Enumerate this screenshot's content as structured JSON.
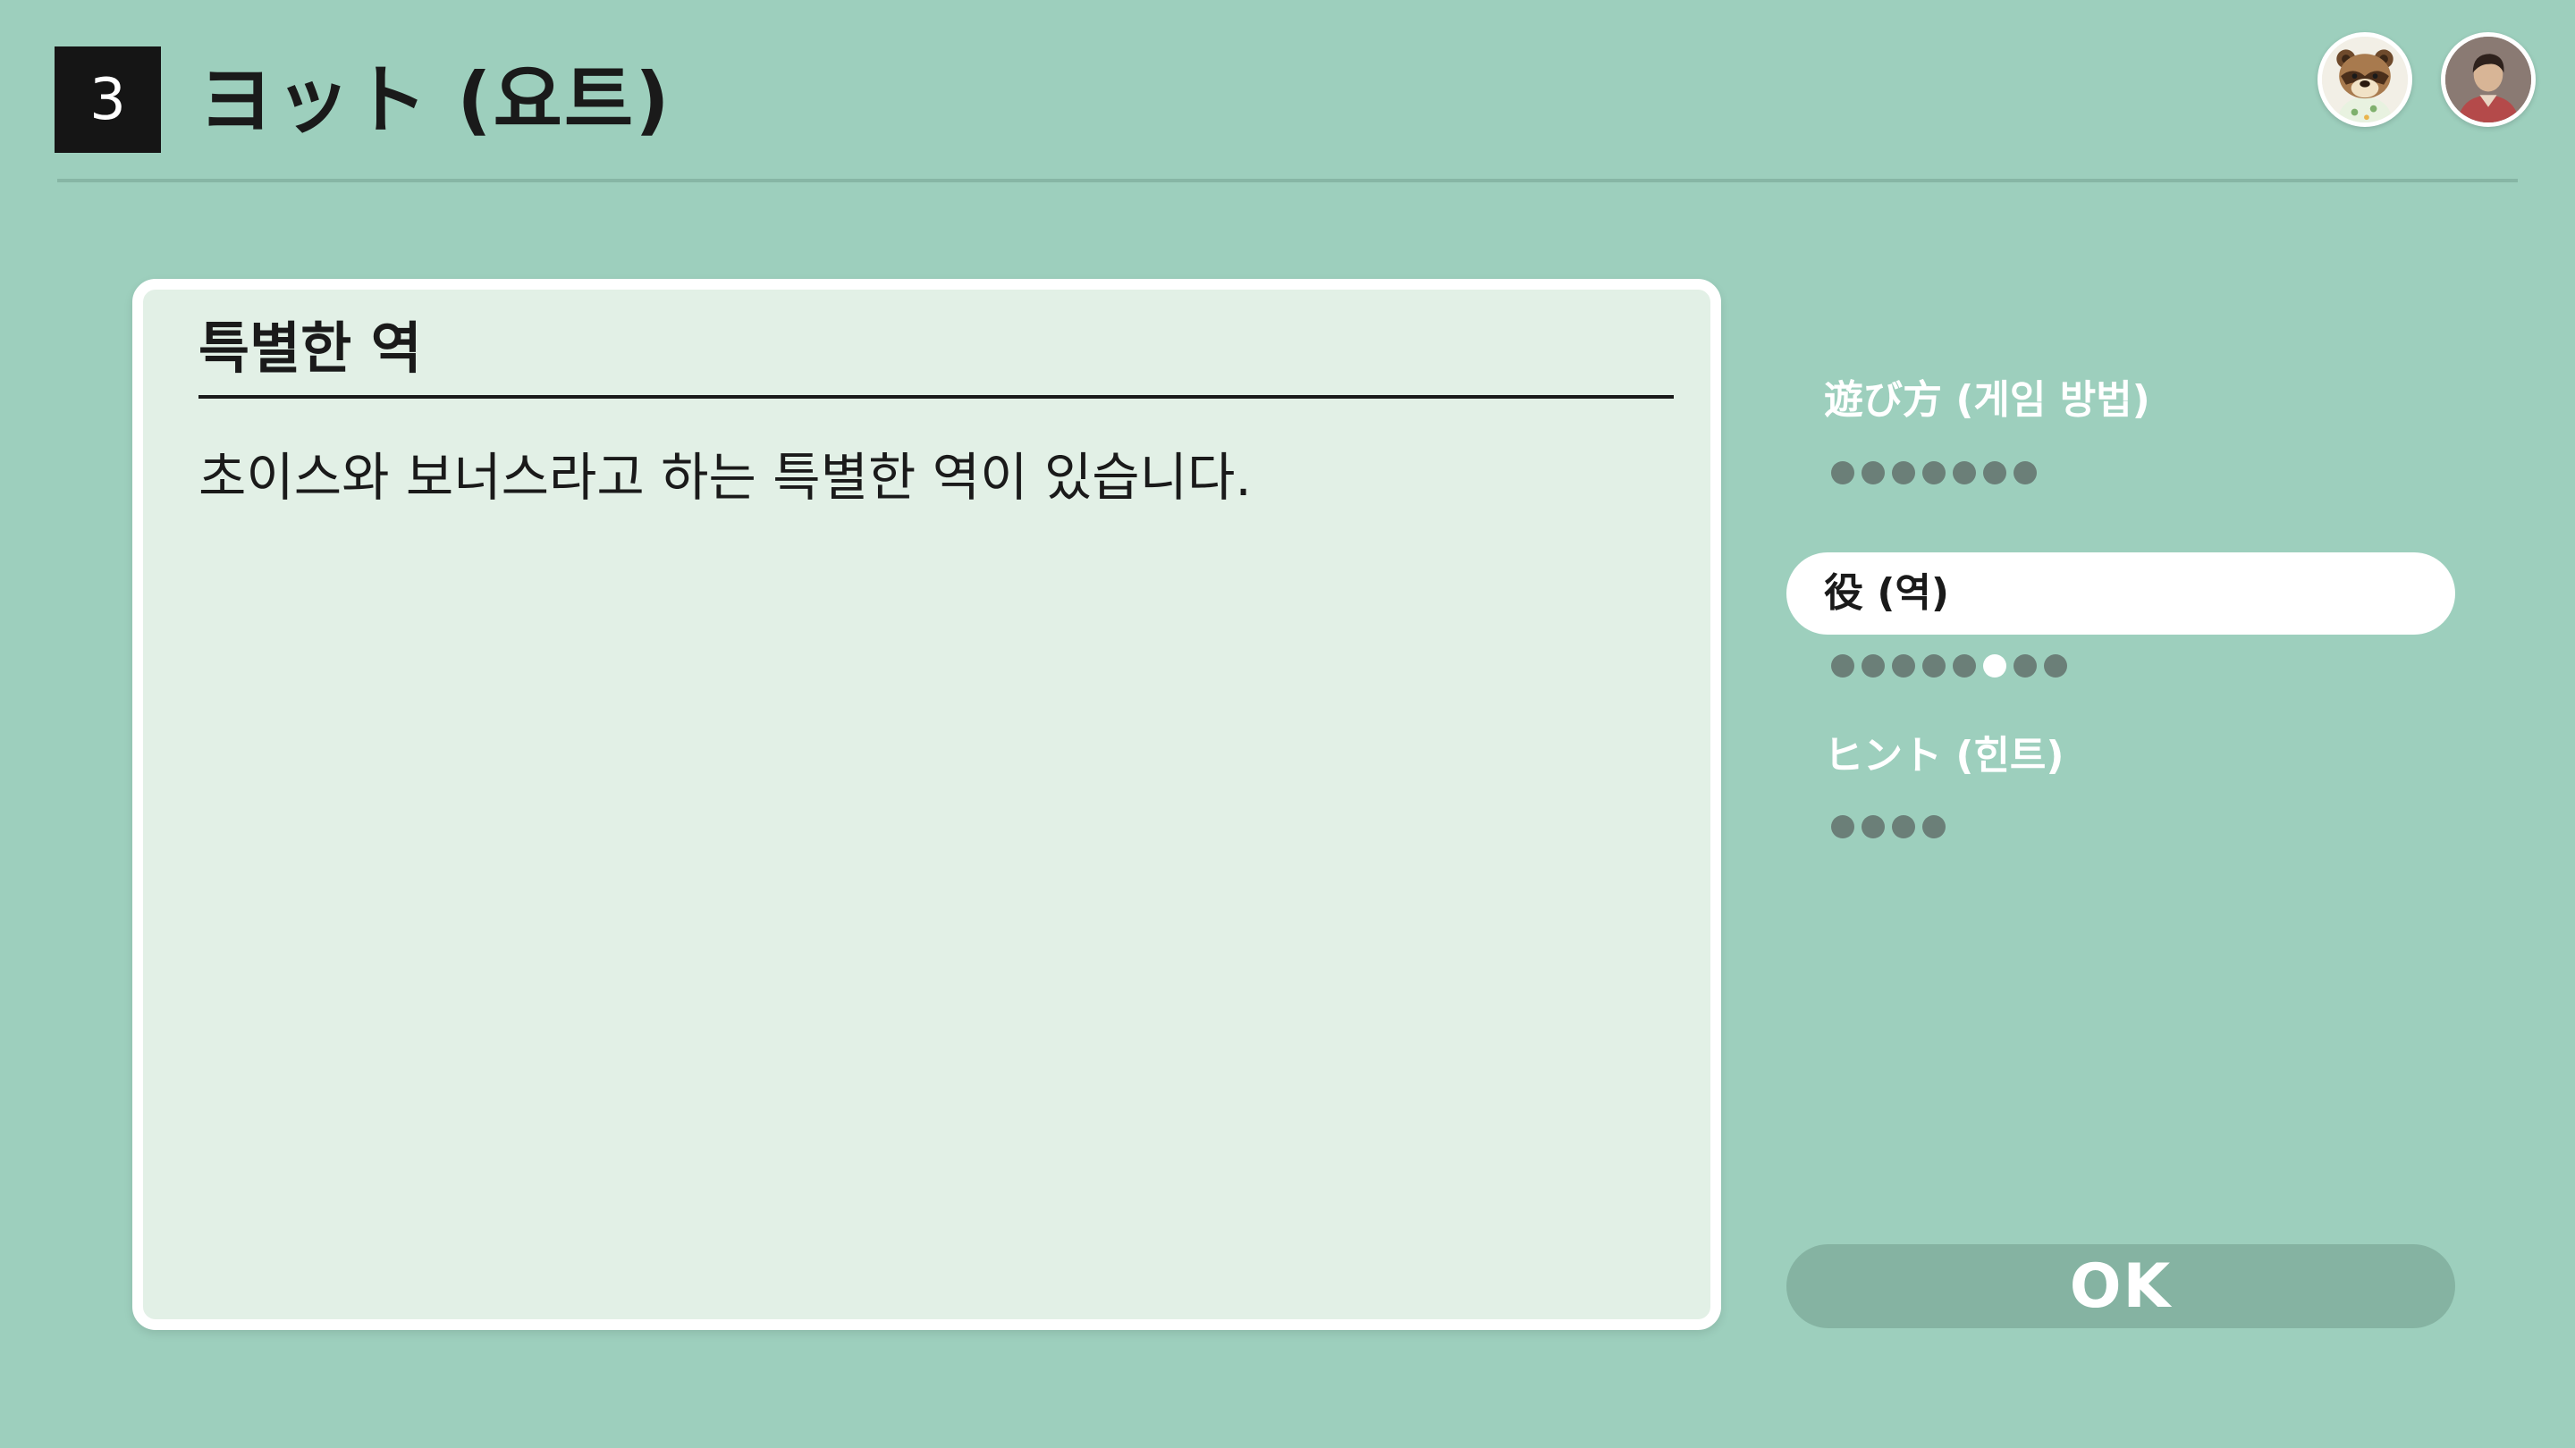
{
  "header": {
    "rule_number": "3",
    "game_title": "ヨット (요트)",
    "avatars": [
      {
        "icon": "tom-nook-avatar-icon"
      },
      {
        "icon": "player-avatar-icon"
      }
    ]
  },
  "panel": {
    "heading": "특별한 역",
    "body": "초이스와 보너스라고 하는 특별한 역이 있습니다."
  },
  "menu": {
    "items": [
      {
        "label": "遊び方 (게임 방법)",
        "pages": 7,
        "current_page": null,
        "selected": false
      },
      {
        "label": "役 (역)",
        "pages": 8,
        "current_page": 6,
        "selected": true
      },
      {
        "label": "ヒント (힌트)",
        "pages": 4,
        "current_page": null,
        "selected": false
      }
    ]
  },
  "ok_button": {
    "label": "OK"
  },
  "colors": {
    "background": "#9dcfbd",
    "panel": "#e2f0e6",
    "dot": "#6b7f78",
    "ok_button": "#85b3a2"
  }
}
